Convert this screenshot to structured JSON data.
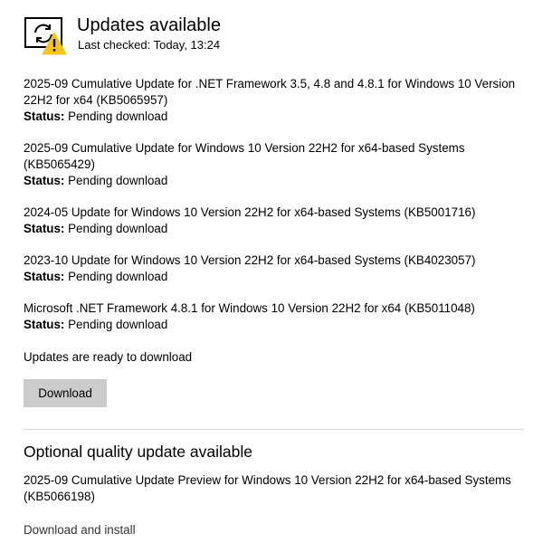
{
  "header": {
    "icon": "sync-warning-icon",
    "title": "Updates available",
    "last_checked": "Last checked: Today, 13:24"
  },
  "updates": [
    {
      "title": "2025-09 Cumulative Update for .NET Framework 3.5, 4.8 and 4.8.1 for Windows 10 Version 22H2 for x64 (KB5065957)",
      "status_label": "Status:",
      "status_value": "Pending download"
    },
    {
      "title": "2025-09 Cumulative Update for Windows 10 Version 22H2 for x64-based Systems (KB5065429)",
      "status_label": "Status:",
      "status_value": "Pending download"
    },
    {
      "title": "2024-05 Update for Windows 10 Version 22H2 for x64-based Systems (KB5001716)",
      "status_label": "Status:",
      "status_value": "Pending download"
    },
    {
      "title": "2023-10 Update for Windows 10 Version 22H2 for x64-based Systems (KB4023057)",
      "status_label": "Status:",
      "status_value": "Pending download"
    },
    {
      "title": "Microsoft .NET Framework 4.8.1 for Windows 10 Version 22H2 for x64 (KB5011048)",
      "status_label": "Status:",
      "status_value": "Pending download"
    }
  ],
  "ready_text": "Updates are ready to download",
  "download_button": "Download",
  "optional": {
    "title": "Optional quality update available",
    "update_title": "2025-09 Cumulative Update Preview for Windows 10 Version 22H2 for x64-based Systems (KB5066198)",
    "link": "Download and install"
  },
  "colors": {
    "warning": "#f5c518",
    "button_bg": "#cccccc",
    "divider": "#d9d9d9"
  }
}
